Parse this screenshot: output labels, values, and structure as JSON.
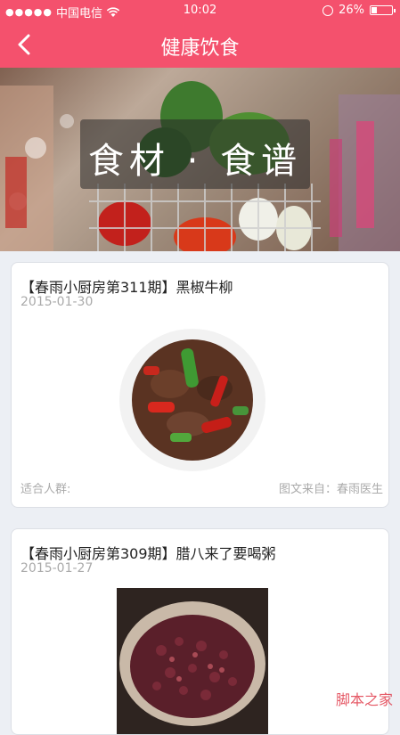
{
  "status": {
    "carrier": "中国电信",
    "time": "10:02",
    "battery_text": "26%",
    "battery_level": 0.26
  },
  "nav": {
    "title": "健康饮食",
    "back_icon": "chevron-left-icon"
  },
  "banner": {
    "text": "食材 · 食谱"
  },
  "articles": [
    {
      "title": "【春雨小厨房第311期】黑椒牛柳",
      "date": "2015-01-30",
      "audience_label": "适合人群:",
      "source_label": "图文来自：春雨医生"
    },
    {
      "title": "【春雨小厨房第309期】腊八来了要喝粥",
      "date": "2015-01-27"
    }
  ],
  "watermark": "脚本之家",
  "colors": {
    "brand": "#f4516d",
    "background": "#eceff4"
  }
}
